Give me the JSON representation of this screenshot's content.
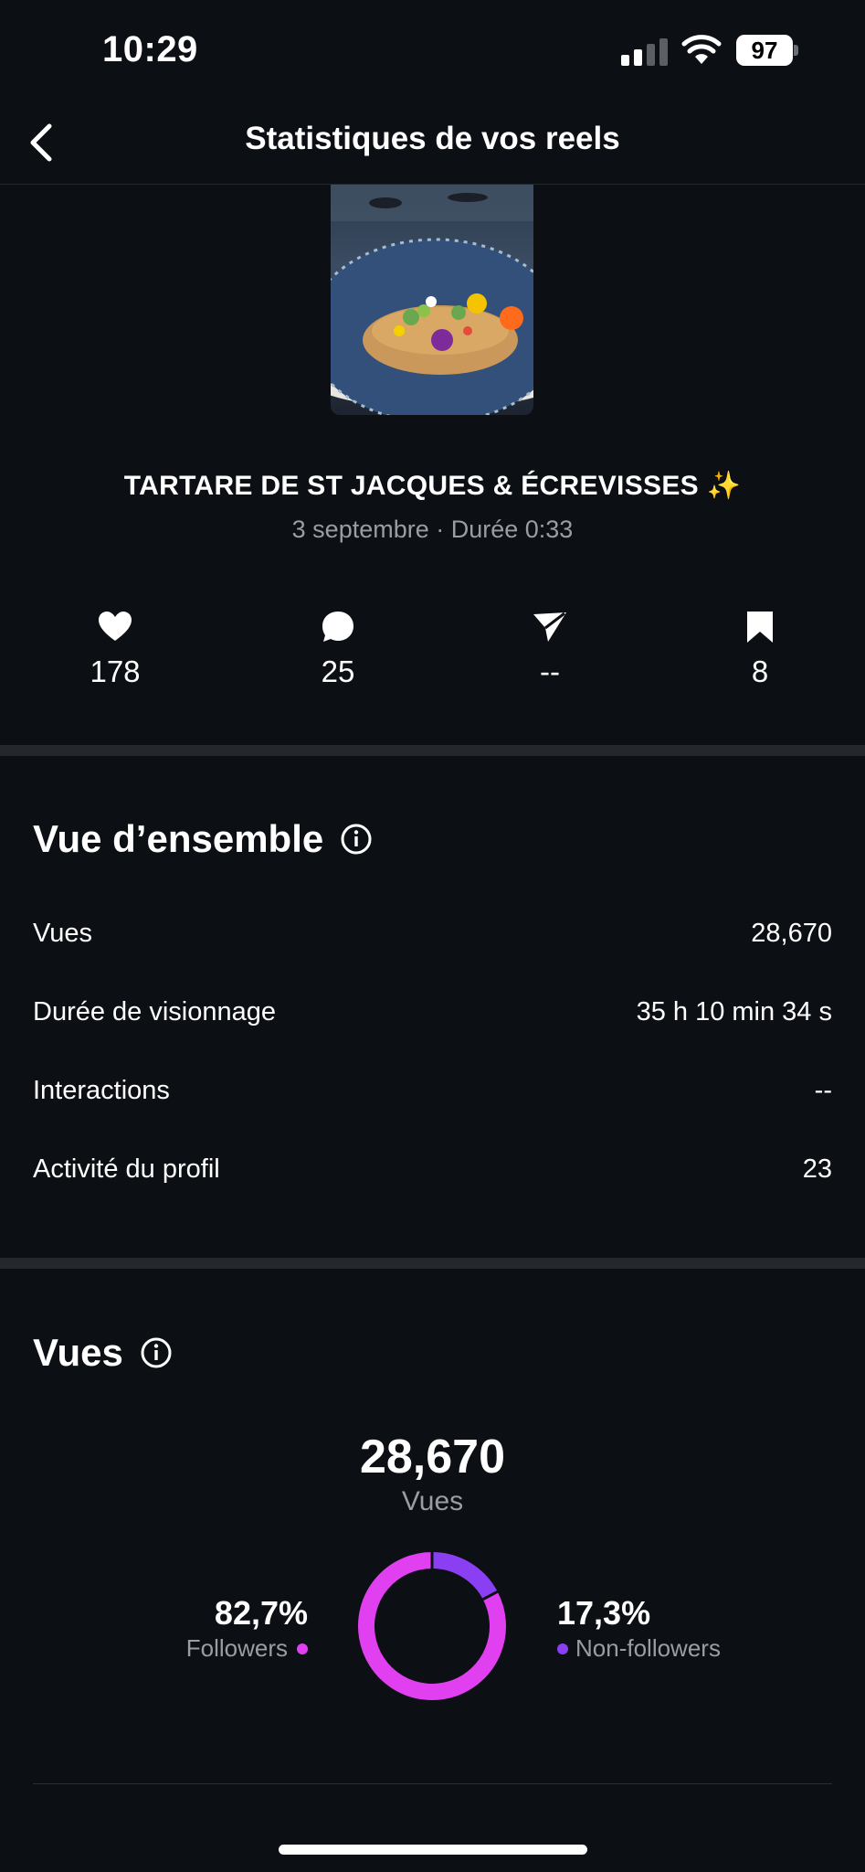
{
  "status_bar": {
    "time": "10:29",
    "battery": "97"
  },
  "nav": {
    "title": "Statistiques de vos reels"
  },
  "reel": {
    "title": "TARTARE DE ST JACQUES & ÉCREVISSES ✨",
    "meta": "3 septembre · Durée 0:33",
    "thumbnail_icon": "food-plate-image"
  },
  "metrics": [
    {
      "icon": "heart-icon",
      "value": "178"
    },
    {
      "icon": "comment-icon",
      "value": "25"
    },
    {
      "icon": "share-icon",
      "value": "--"
    },
    {
      "icon": "bookmark-icon",
      "value": "8"
    }
  ],
  "overview": {
    "title": "Vue d’ensemble",
    "rows": [
      {
        "label": "Vues",
        "value": "28,670"
      },
      {
        "label": "Durée de visionnage",
        "value": "35 h 10 min 34 s"
      },
      {
        "label": "Interactions",
        "value": "--"
      },
      {
        "label": "Activité du profil",
        "value": "23"
      }
    ]
  },
  "views": {
    "title": "Vues",
    "total": "28,670",
    "total_label": "Vues",
    "followers_pct": "82,7%",
    "followers_label": "Followers",
    "non_followers_pct": "17,3%",
    "non_followers_label": "Non-followers"
  },
  "chart_data": {
    "type": "pie",
    "categories": [
      "Followers",
      "Non-followers"
    ],
    "values": [
      82.7,
      17.3
    ],
    "colors": [
      "#e040f0",
      "#8a3ff2"
    ]
  },
  "colors": {
    "background": "#0c0f14",
    "followers": "#e040f0",
    "non_followers": "#8a3ff2"
  }
}
